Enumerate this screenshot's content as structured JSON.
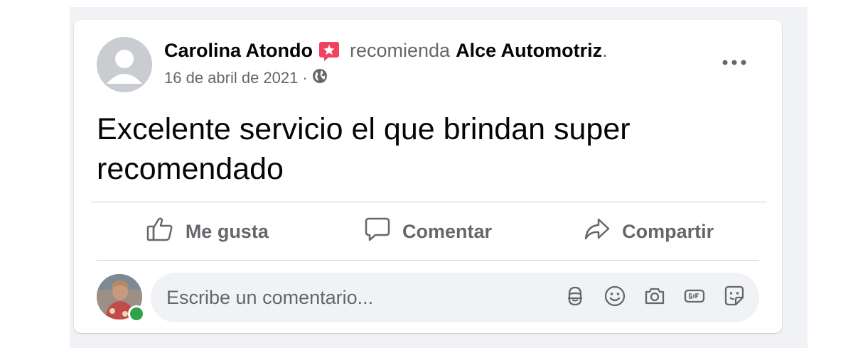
{
  "post": {
    "author": "Carolina Atondo",
    "recommends_text": "recomienda",
    "business": "Alce Automotriz",
    "period": ".",
    "date": "16 de abril de 2021",
    "separator": "·",
    "text": "Excelente servicio el que brindan super recomendado"
  },
  "actions": {
    "like_label": "Me gusta",
    "comment_label": "Comentar",
    "share_label": "Compartir"
  },
  "comment": {
    "placeholder": "Escribe un comentario..."
  },
  "icons": {
    "badge": "recommendation-badge-icon",
    "privacy": "globe-icon",
    "more": "more-options-icon",
    "like": "thumbs-up-icon",
    "comment": "speech-bubble-icon",
    "share": "share-arrow-icon",
    "comment_tools": [
      "avatar-sticker-icon",
      "emoji-icon",
      "camera-icon",
      "gif-icon",
      "sticker-icon"
    ]
  },
  "colors": {
    "text_primary": "#050505",
    "text_secondary": "#65676b",
    "badge": "#f3425f",
    "online": "#31a24c",
    "surface": "#f0f2f5"
  }
}
